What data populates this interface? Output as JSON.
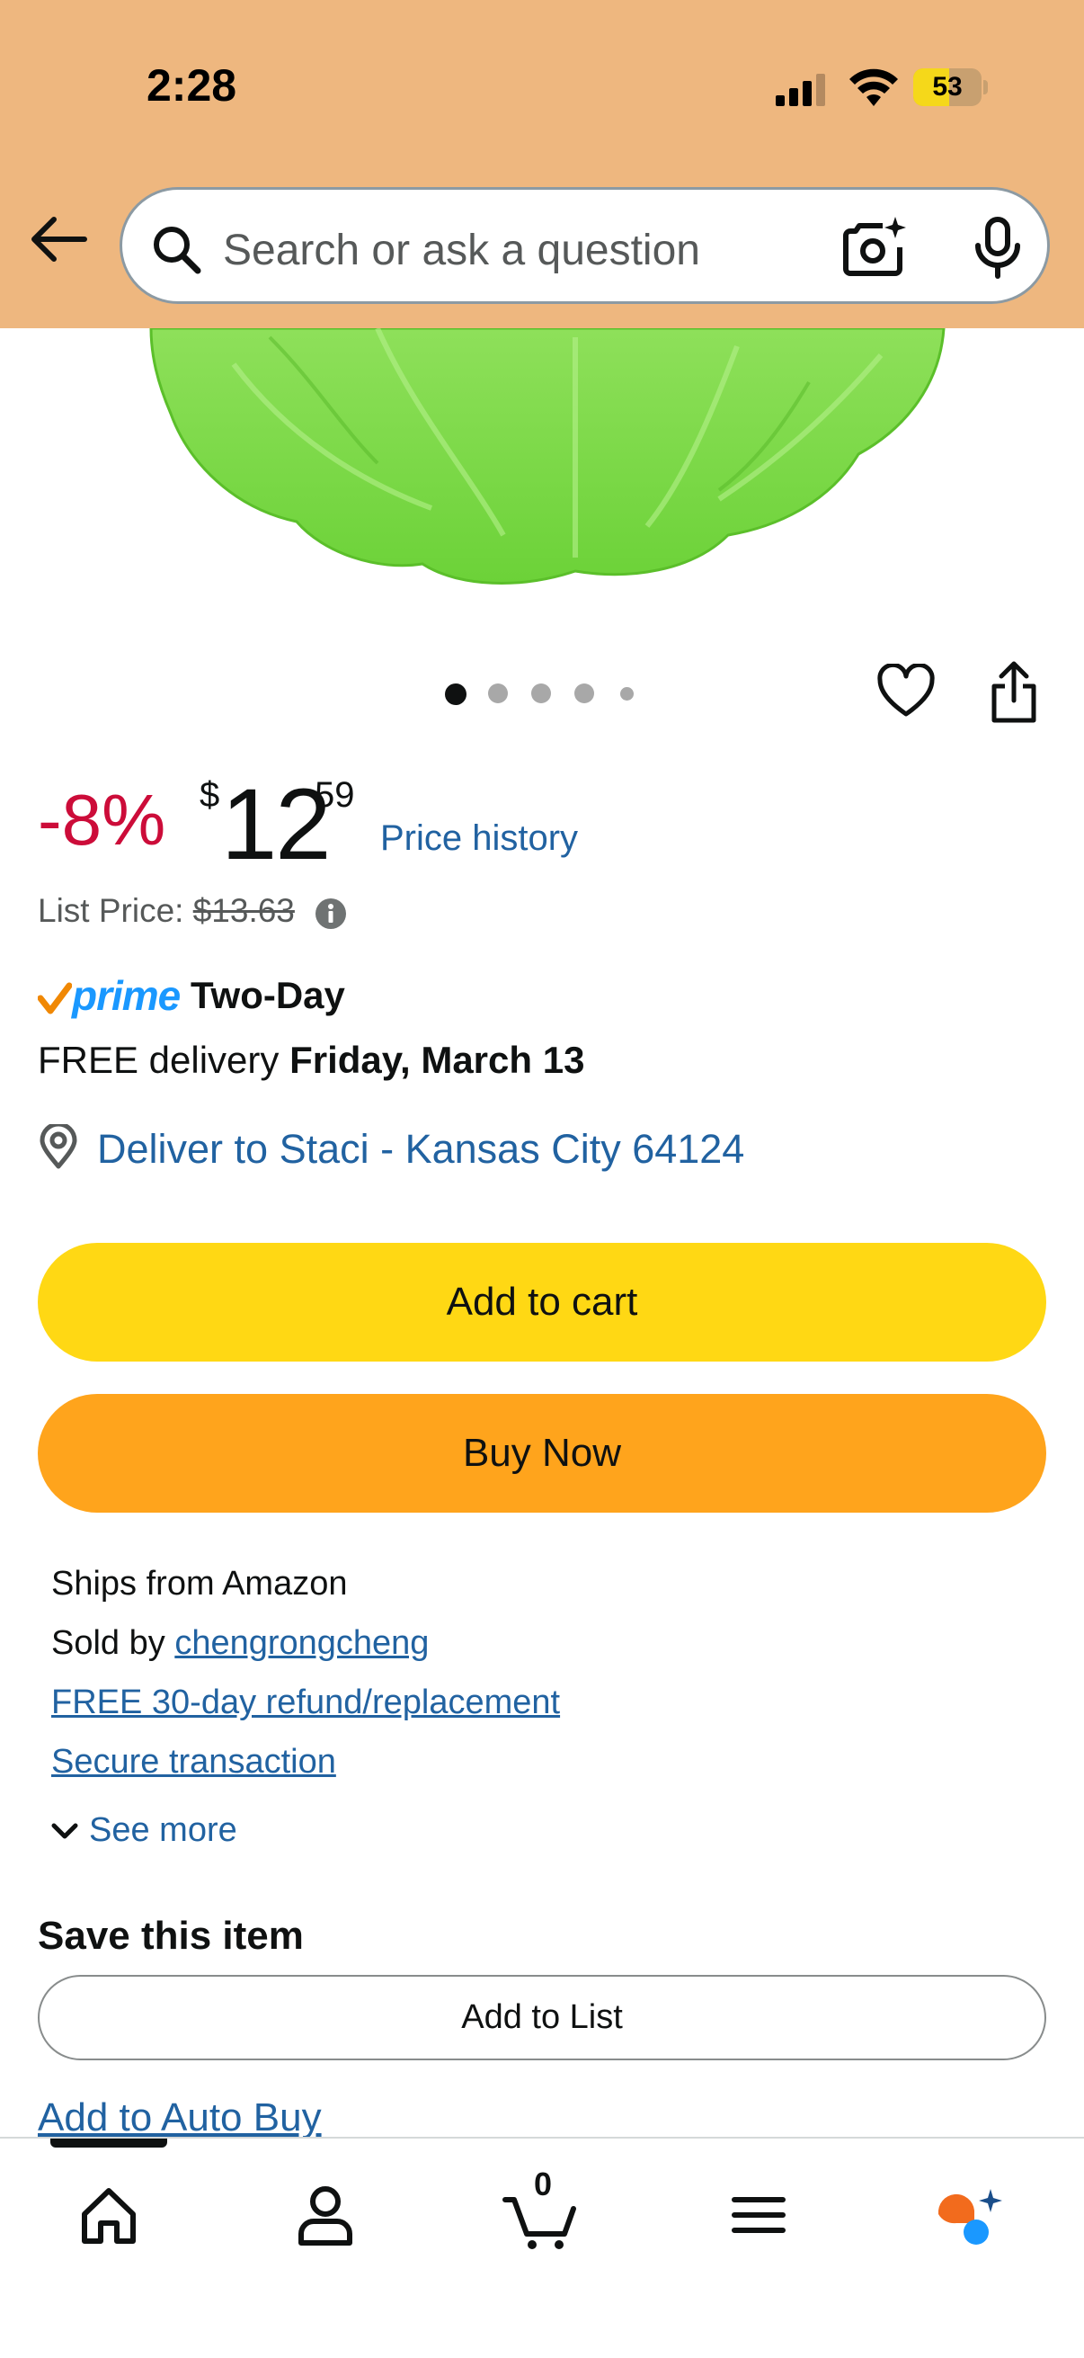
{
  "status_bar": {
    "time": "2:28",
    "battery": "53",
    "battery_level": 0.53
  },
  "search": {
    "placeholder": "Search or ask a question"
  },
  "carousel": {
    "total_images": 5,
    "active_index": 0
  },
  "price": {
    "discount": "-8%",
    "currency_symbol": "$",
    "whole": "12",
    "fraction": "59",
    "price_history_label": "Price history",
    "list_price_label": "List Price:",
    "list_price_value": "$13.63"
  },
  "delivery": {
    "prime_label": "prime",
    "prime_speed": "Two-Day",
    "free_delivery_label": "FREE delivery",
    "delivery_date": "Friday, March 13",
    "deliver_to": "Deliver to Staci - Kansas City 64124"
  },
  "actions": {
    "add_to_cart": "Add to cart",
    "buy_now": "Buy Now"
  },
  "seller_info": {
    "ships_from": "Ships from Amazon",
    "sold_by_label": "Sold by",
    "seller_name": "chengrongcheng",
    "refund": "FREE 30-day refund/replacement",
    "secure": "Secure transaction",
    "see_more": "See more"
  },
  "save": {
    "title": "Save this item",
    "add_to_list": "Add to List",
    "auto_buy": "Add to Auto Buy"
  },
  "bottom_nav": {
    "cart_count": "0"
  },
  "colors": {
    "header_bg": "#eeb77f",
    "discount": "#cc0c39",
    "link": "#2162a1",
    "add_to_cart": "#ffd814",
    "buy_now": "#ffa41c",
    "prime": "#1a98ff"
  }
}
